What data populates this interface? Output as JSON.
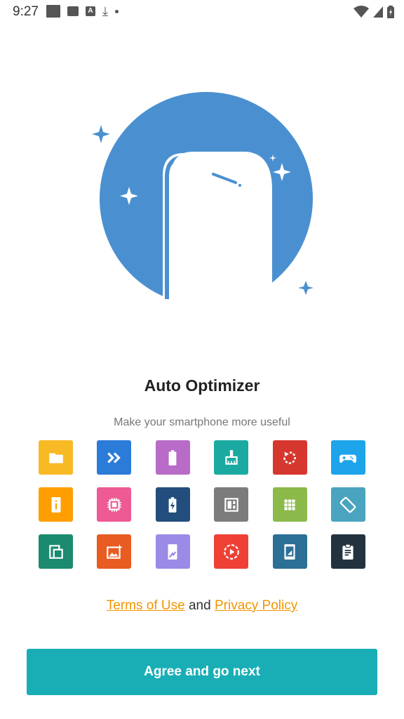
{
  "status_bar": {
    "time": "9:27",
    "icons": [
      "square-notification-icon",
      "image-icon",
      "a-icon",
      "download-icon",
      "dot-icon"
    ],
    "right_icons": [
      "wifi-icon",
      "signal-icon",
      "battery-icon"
    ]
  },
  "hero": {
    "icon": "phone-sparkle-illustration",
    "circle_color": "#4A90D0"
  },
  "title": "Auto Optimizer",
  "subtitle": "Make your smartphone more useful",
  "features": [
    {
      "name": "folder",
      "color": "#F7B924"
    },
    {
      "name": "fast-forward",
      "color": "#2B7BD9"
    },
    {
      "name": "battery",
      "color": "#B86BC7"
    },
    {
      "name": "broom",
      "color": "#1BAAA1"
    },
    {
      "name": "restart",
      "color": "#D5372E"
    },
    {
      "name": "gamepad",
      "color": "#1EA4EA"
    },
    {
      "name": "device-info",
      "color": "#FF9E00"
    },
    {
      "name": "chip",
      "color": "#EE5A93"
    },
    {
      "name": "charging",
      "color": "#234D7D"
    },
    {
      "name": "widget",
      "color": "#7C7C7C"
    },
    {
      "name": "app-grid",
      "color": "#8BB94A"
    },
    {
      "name": "rotate-screen",
      "color": "#4BA4BF"
    },
    {
      "name": "layers",
      "color": "#1B8A6E"
    },
    {
      "name": "wallpaper",
      "color": "#E85B21"
    },
    {
      "name": "phone-hand",
      "color": "#9B8AE6"
    },
    {
      "name": "play-timer",
      "color": "#EE4035"
    },
    {
      "name": "tablet",
      "color": "#2C6F97"
    },
    {
      "name": "clipboard",
      "color": "#22323F"
    }
  ],
  "legal": {
    "terms_label": "Terms of Use",
    "and_text": "and",
    "privacy_label": "Privacy Policy",
    "link_color": "#F29500"
  },
  "cta": {
    "label": "Agree and go next",
    "color": "#19AEB5"
  }
}
